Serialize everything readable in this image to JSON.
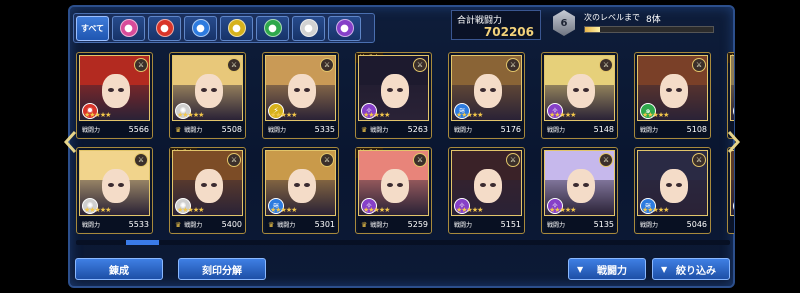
{
  "filter_tabs": [
    {
      "label": "すべて",
      "icon": "all",
      "active": true
    },
    {
      "icon": "star-icon",
      "color": "#d84c9a"
    },
    {
      "icon": "fire-icon",
      "color": "#d9352a"
    },
    {
      "icon": "water-icon",
      "color": "#2d7bdf"
    },
    {
      "icon": "thunder-icon",
      "color": "#d6b21c"
    },
    {
      "icon": "wind-icon",
      "color": "#2fa84c"
    },
    {
      "icon": "light-icon",
      "color": "#d2d2d2"
    },
    {
      "icon": "dark-icon",
      "color": "#8640c8"
    }
  ],
  "header": {
    "total_power_label": "合計戦闘力",
    "total_power_value": "702206",
    "level": "6",
    "next_level_label": "次のレベルまで",
    "next_level_count": "8体",
    "level_progress": 0.12
  },
  "cards": [
    {
      "power": "5566",
      "stat_label": "戦闘力",
      "attr": "fire",
      "hair": "#b32a20",
      "row": 0,
      "col": 0,
      "crown": false,
      "formation": ""
    },
    {
      "power": "5508",
      "stat_label": "戦闘力",
      "attr": "light",
      "hair": "#e8c87a",
      "row": 0,
      "col": 1,
      "crown": true,
      "formation": ""
    },
    {
      "power": "5335",
      "stat_label": "戦闘力",
      "attr": "thunder",
      "hair": "#c99a56",
      "row": 0,
      "col": 2,
      "crown": false,
      "formation": ""
    },
    {
      "power": "5263",
      "stat_label": "戦闘力",
      "attr": "dark",
      "hair": "#1d1a2e",
      "row": 0,
      "col": 3,
      "crown": true,
      "formation": "編成中"
    },
    {
      "power": "5176",
      "stat_label": "戦闘力",
      "attr": "water",
      "hair": "#8a6436",
      "row": 0,
      "col": 4,
      "crown": false,
      "formation": ""
    },
    {
      "power": "5148",
      "stat_label": "戦闘力",
      "attr": "dark",
      "hair": "#e6d07a",
      "row": 0,
      "col": 5,
      "crown": false,
      "formation": ""
    },
    {
      "power": "5108",
      "stat_label": "戦闘力",
      "attr": "wind",
      "hair": "#7a4028",
      "row": 0,
      "col": 6,
      "crown": false,
      "formation": ""
    },
    {
      "power": "",
      "stat_label": "",
      "attr": "dark",
      "hair": "#8b7a55",
      "row": 0,
      "col": 7,
      "crown": false,
      "formation": "編成中"
    },
    {
      "power": "5533",
      "stat_label": "戦闘力",
      "attr": "light",
      "hair": "#f1d48c",
      "row": 1,
      "col": 0,
      "crown": false,
      "formation": ""
    },
    {
      "power": "5400",
      "stat_label": "戦闘力",
      "attr": "light",
      "hair": "#7c4c26",
      "row": 1,
      "col": 1,
      "crown": true,
      "formation": "編成中"
    },
    {
      "power": "5301",
      "stat_label": "戦闘力",
      "attr": "water",
      "hair": "#c99a4a",
      "row": 1,
      "col": 2,
      "crown": true,
      "formation": ""
    },
    {
      "power": "5259",
      "stat_label": "戦闘力",
      "attr": "dark",
      "hair": "#e8847a",
      "row": 1,
      "col": 3,
      "crown": true,
      "formation": "編成中"
    },
    {
      "power": "5151",
      "stat_label": "戦闘力",
      "attr": "dark",
      "hair": "#3a2228",
      "row": 1,
      "col": 4,
      "crown": false,
      "formation": ""
    },
    {
      "power": "5135",
      "stat_label": "戦闘力",
      "attr": "dark",
      "hair": "#c6b8ec",
      "row": 1,
      "col": 5,
      "crown": false,
      "formation": ""
    },
    {
      "power": "5046",
      "stat_label": "戦闘力",
      "attr": "water",
      "hair": "#2a2a44",
      "row": 1,
      "col": 6,
      "crown": false,
      "formation": ""
    },
    {
      "power": "",
      "stat_label": "",
      "attr": "wind",
      "hair": "#5a3a2a",
      "row": 1,
      "col": 7,
      "crown": false,
      "formation": ""
    }
  ],
  "buttons": {
    "refine": "錬成",
    "seal_dismantle": "刻印分解",
    "sort": "戦闘力",
    "filter": "絞り込み"
  },
  "scroll_position": 0.08
}
